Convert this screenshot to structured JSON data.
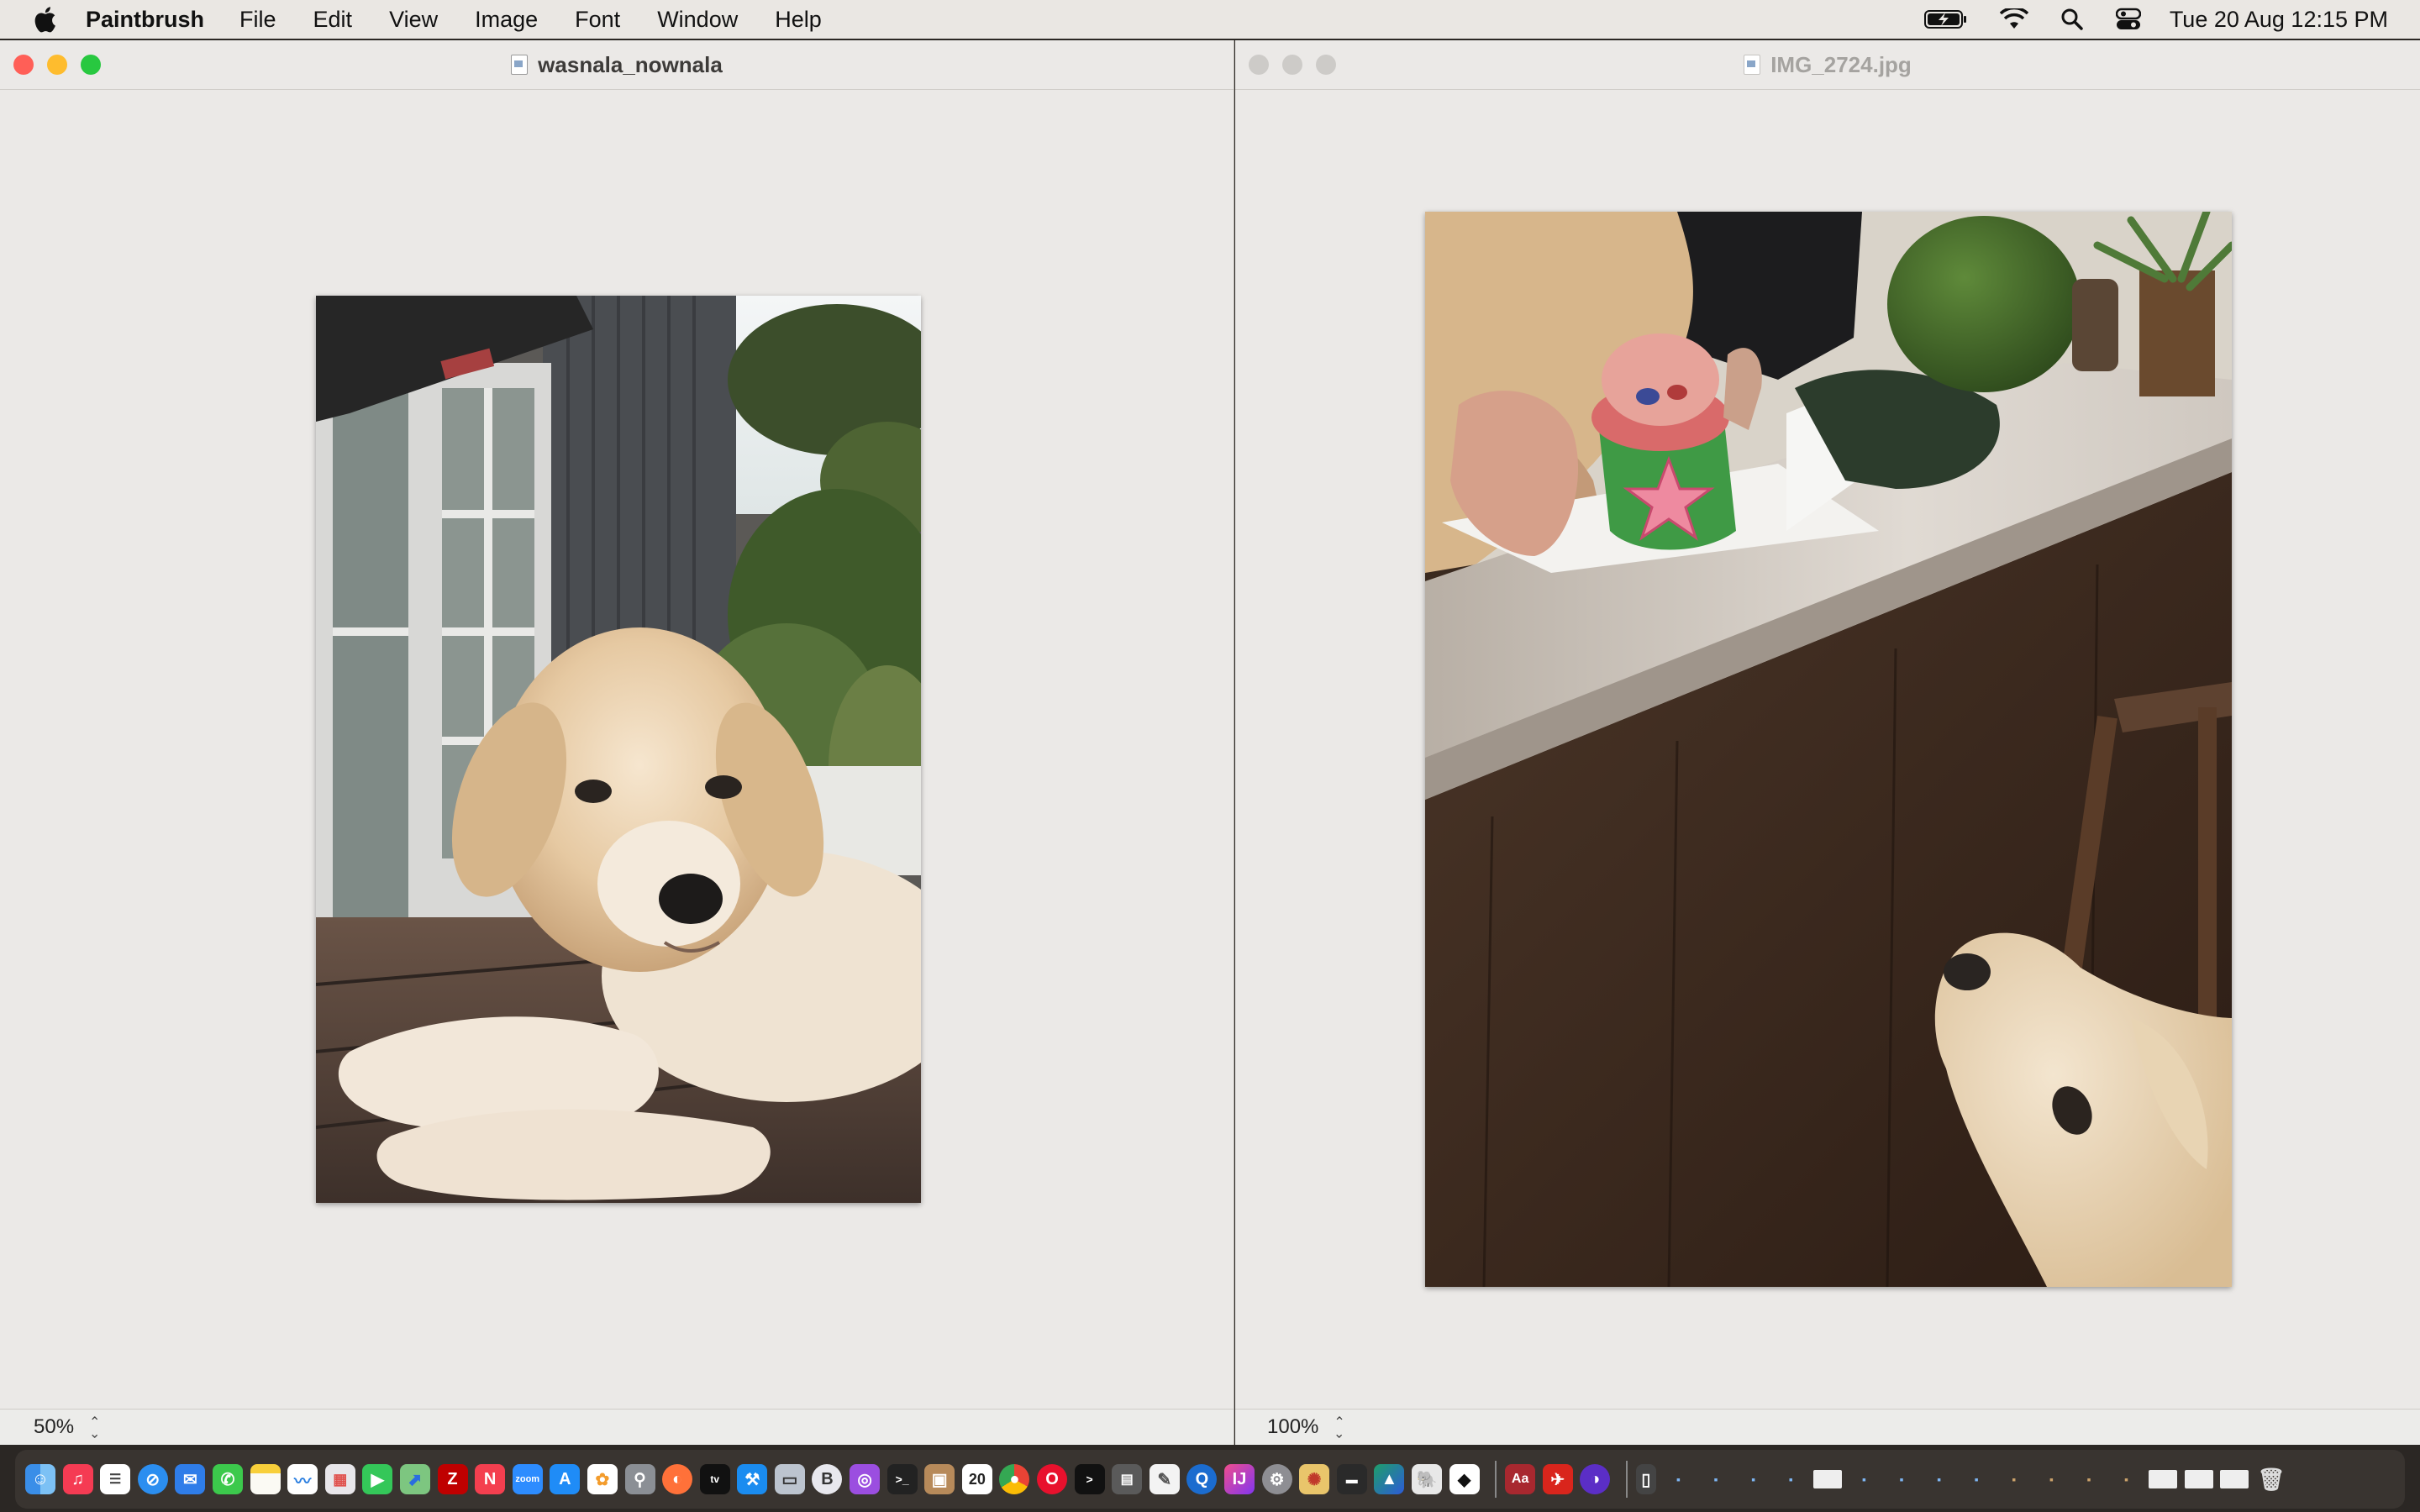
{
  "menubar": {
    "app_name": "Paintbrush",
    "items": [
      "File",
      "Edit",
      "View",
      "Image",
      "Font",
      "Window",
      "Help"
    ],
    "status_icons": [
      "battery-charging-icon",
      "wifi-icon",
      "spotlight-search-icon",
      "control-center-icon"
    ],
    "clock": "Tue 20 Aug  12:15 PM"
  },
  "windows": [
    {
      "title": "wasnala_nownala",
      "active": true,
      "zoom": "50%",
      "image_description_icon": "golden-retriever-puppy-photo"
    },
    {
      "title": "IMG_2724.jpg",
      "active": false,
      "zoom": "100%",
      "image_description_icon": "kitchen-counter-cake-dog-photo"
    }
  ],
  "dock": {
    "apps": [
      "finder",
      "music",
      "reminders",
      "safari",
      "mail",
      "messages",
      "notes",
      "freeform",
      "launchpad",
      "facetime",
      "maps",
      "filezilla",
      "news",
      "zoom",
      "app-store",
      "photos",
      "preview",
      "firefox",
      "apple-tv",
      "xcode",
      "image-capture",
      "bbedit",
      "podcasts",
      "terminal",
      "contacts",
      "calendar",
      "chrome",
      "opera",
      "terminal-dark",
      "calculator",
      "textedit",
      "quicktime",
      "intellij",
      "system-settings",
      "paintbrush",
      "console",
      "affinity",
      "mastodon",
      "inkscape",
      "dictionary",
      "acrobat",
      "firefox-nightly",
      "iphone-mirroring"
    ],
    "calendar_day": "20",
    "colors": {
      "dock_bg": "#3c3732"
    }
  },
  "colors": {
    "close": "#ff5f57",
    "minimize": "#febc2e",
    "zoom": "#28c840",
    "inactive": "#cdcbc8"
  }
}
